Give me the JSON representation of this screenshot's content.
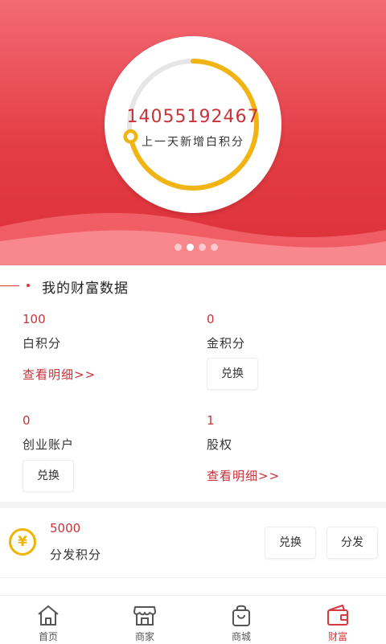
{
  "hero": {
    "points_value": "14055192467",
    "points_caption": "上一天新增白积分",
    "ring_progress": 0.72,
    "carousel_dots": 4,
    "carousel_active": 1
  },
  "section": {
    "title": "我的财富数据"
  },
  "stats": [
    {
      "value": "100",
      "label": "白积分",
      "action": "查看明细>>",
      "action_type": "link"
    },
    {
      "value": "0",
      "label": "金积分",
      "action": "兑换",
      "action_type": "button"
    },
    {
      "value": "0",
      "label": "创业账户",
      "action": "兑换",
      "action_type": "button"
    },
    {
      "value": "1",
      "label": "股权",
      "action": "查看明细>>",
      "action_type": "link"
    }
  ],
  "distribution": {
    "icon": "yuan-coin-icon",
    "icon_glyph": "¥",
    "value": "5000",
    "label": "分发积分",
    "exchange_button": "兑换",
    "distribute_button": "分发"
  },
  "tabs": [
    {
      "label": "首页",
      "icon": "home-icon"
    },
    {
      "label": "商家",
      "icon": "store-icon"
    },
    {
      "label": "商城",
      "icon": "shopping-bag-icon"
    },
    {
      "label": "财富",
      "icon": "wallet-icon",
      "active": true
    }
  ],
  "colors": {
    "accent": "#d33a40",
    "hero_top": "#f36a73",
    "hero_bottom": "#dc3038",
    "gold": "#f0b400"
  }
}
